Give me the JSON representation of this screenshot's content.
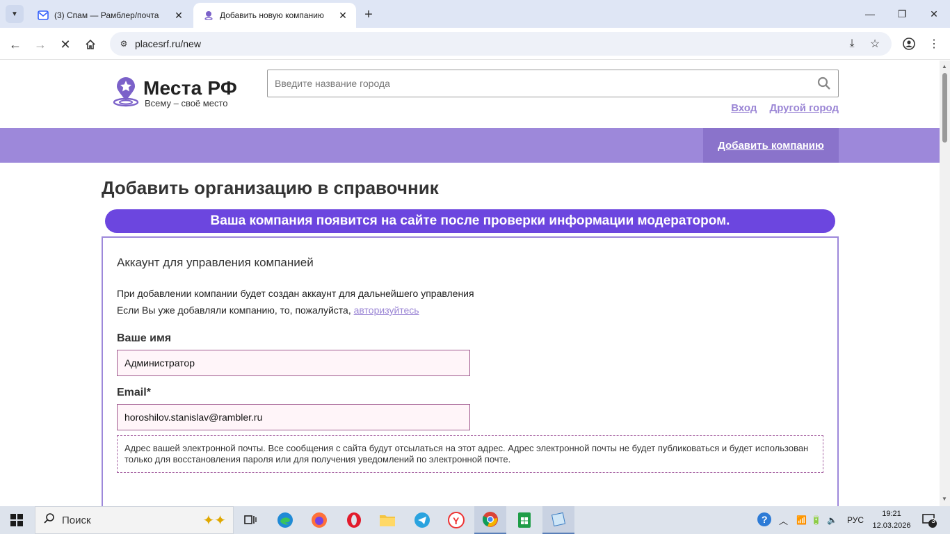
{
  "browser": {
    "tabs": [
      {
        "title": "(3) Спам — Рамблер/почта",
        "icon": "mail-icon",
        "active": false
      },
      {
        "title": "Добавить новую компанию",
        "icon": "map-pin-icon",
        "active": true
      }
    ],
    "address": "placesrf.ru/new"
  },
  "site": {
    "brand": "Места РФ",
    "tagline": "Всему – своё место",
    "search_placeholder": "Введите название города",
    "links": {
      "login": "Вход",
      "other_city": "Другой город"
    },
    "nav": {
      "add_company": "Добавить компанию"
    },
    "accent_color": "#9d88da",
    "notice_color": "#6c46df"
  },
  "page": {
    "title": "Добавить организацию в справочник",
    "notice": "Ваша компания появится на сайте после проверки информации модератором.",
    "section_title": "Аккаунт для управления компанией",
    "info_line1": "При добавлении компании будет создан аккаунт для дальнейшего управления",
    "info_line2_prefix": "Если Вы уже добавляли компанию, то, пожалуйста, ",
    "info_line2_link": "авторизуйтесь",
    "fields": {
      "name_label": "Ваше имя",
      "name_value": "Администратор",
      "email_label": "Email*",
      "email_value": "horoshilov.stanislav@rambler.ru"
    },
    "email_hint": "Адрес вашей электронной почты. Все сообщения с сайта будут отсылаться на этот адрес. Адрес электронной почты не будет публиковаться и будет использован только для восстановления пароля или для получения уведомлений по электронной почте."
  },
  "taskbar": {
    "search_label": "Поиск",
    "language": "РУС",
    "time": "19:21",
    "date": "12.03.2026",
    "notifications": "3"
  }
}
